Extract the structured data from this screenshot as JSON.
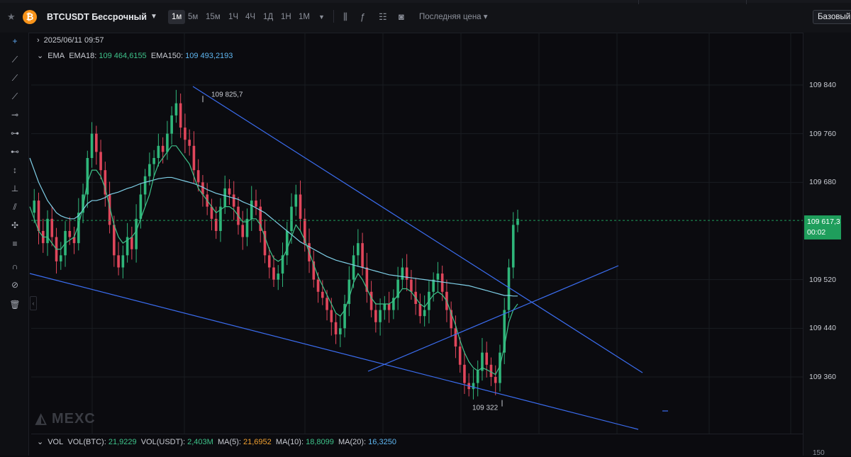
{
  "header": {
    "symbol": "BTCUSDT Бессрочный",
    "timeframes": [
      "1м",
      "5м",
      "15м",
      "1Ч",
      "4Ч",
      "1Д",
      "1Н",
      "1М"
    ],
    "active_timeframe": "1м",
    "last_price_label": "Последняя цена",
    "basic_button": "Базовый"
  },
  "legend": {
    "datetime": "2025/06/11 09:57",
    "ema_title": "EMA",
    "ema18_label": "EMA18:",
    "ema18_value": "109 464,6155",
    "ema150_label": "EMA150:",
    "ema150_value": "109 493,2193"
  },
  "volume": {
    "title": "VOL",
    "btc_label": "VOL(BTC):",
    "btc_value": "21,9229",
    "usdt_label": "VOL(USDT):",
    "usdt_value": "2,403M",
    "ma5_label": "MA(5):",
    "ma5_value": "21,6952",
    "ma10_label": "MA(10):",
    "ma10_value": "18,8099",
    "ma20_label": "MA(20):",
    "ma20_value": "16,3250"
  },
  "watermark": "MEXC",
  "bottom_axis_partial": "150",
  "colors": {
    "up": "#2fb67a",
    "down": "#e0465b",
    "ema18": "#3ec28a",
    "ema150": "#7fd0e8",
    "trendline": "#3b6df0",
    "current": "#1f9e5c"
  },
  "chart_data": {
    "type": "candlestick",
    "ylim": [
      109290,
      109890
    ],
    "yticks": [
      "109 840",
      "109 760",
      "109 680",
      "109 520",
      "109 440",
      "109 360"
    ],
    "ytick_values": [
      109840,
      109760,
      109680,
      109520,
      109440,
      109360
    ],
    "current_price": "109 617,3",
    "current_price_value": 109617.3,
    "countdown": "00:02",
    "high_annotation": "109 825,7",
    "high_value": 109825.7,
    "low_annotation": "109 322",
    "low_value": 109322,
    "close_series": [
      109630,
      109650,
      109600,
      109580,
      109620,
      109590,
      109550,
      109560,
      109600,
      109590,
      109580,
      109630,
      109660,
      109720,
      109760,
      109730,
      109700,
      109660,
      109610,
      109560,
      109540,
      109560,
      109590,
      109570,
      109620,
      109660,
      109690,
      109710,
      109720,
      109740,
      109730,
      109760,
      109790,
      109810,
      109770,
      109750,
      109740,
      109700,
      109680,
      109660,
      109640,
      109620,
      109600,
      109640,
      109670,
      109660,
      109640,
      109610,
      109590,
      109620,
      109650,
      109640,
      109600,
      109560,
      109540,
      109520,
      109530,
      109560,
      109600,
      109640,
      109660,
      109620,
      109580,
      109550,
      109520,
      109500,
      109490,
      109470,
      109450,
      109430,
      109440,
      109480,
      109520,
      109560,
      109580,
      109540,
      109500,
      109470,
      109450,
      109470,
      109480,
      109470,
      109490,
      109520,
      109540,
      109520,
      109500,
      109480,
      109460,
      109470,
      109500,
      109520,
      109530,
      109500,
      109470,
      109440,
      109410,
      109380,
      109350,
      109340,
      109350,
      109370,
      109400,
      109380,
      109360,
      109350,
      109400,
      109470,
      109540,
      109610,
      109620
    ],
    "ema18_series": [
      109640,
      109620,
      109600,
      109590,
      109590,
      109580,
      109570,
      109570,
      109580,
      109585,
      109590,
      109610,
      109640,
      109680,
      109700,
      109700,
      109690,
      109670,
      109640,
      109610,
      109590,
      109580,
      109585,
      109590,
      109600,
      109620,
      109640,
      109660,
      109690,
      109710,
      109720,
      109730,
      109740,
      109740,
      109730,
      109720,
      109710,
      109690,
      109670,
      109660,
      109650,
      109640,
      109630,
      109635,
      109640,
      109640,
      109635,
      109625,
      109615,
      109615,
      109620,
      109620,
      109610,
      109590,
      109570,
      109555,
      109550,
      109555,
      109570,
      109590,
      109610,
      109600,
      109585,
      109565,
      109545,
      109525,
      109510,
      109495,
      109480,
      109465,
      109460,
      109470,
      109490,
      109515,
      109530,
      109520,
      109505,
      109490,
      109480,
      109480,
      109480,
      109480,
      109485,
      109495,
      109505,
      109505,
      109500,
      109490,
      109480,
      109475,
      109485,
      109495,
      109500,
      109495,
      109485,
      109465,
      109445,
      109420,
      109400,
      109385,
      109375,
      109370,
      109375,
      109372,
      109368,
      109364,
      109378,
      109410,
      109450,
      109470,
      109480
    ],
    "ema150_series": [
      109720,
      109700,
      109680,
      109665,
      109650,
      109640,
      109630,
      109625,
      109622,
      109620,
      109620,
      109625,
      109635,
      109645,
      109650,
      109650,
      109652,
      109655,
      109660,
      109662,
      109664,
      109667,
      109670,
      109672,
      109675,
      109678,
      109680,
      109682,
      109684,
      109686,
      109687,
      109688,
      109688,
      109686,
      109684,
      109682,
      109680,
      109678,
      109675,
      109672,
      109668,
      109665,
      109662,
      109660,
      109658,
      109656,
      109654,
      109652,
      109648,
      109645,
      109642,
      109638,
      109634,
      109630,
      109624,
      109618,
      109612,
      109606,
      109600,
      109594,
      109588,
      109582,
      109578,
      109574,
      109570,
      109566,
      109562,
      109558,
      109555,
      109552,
      109550,
      109548,
      109546,
      109544,
      109542,
      109540,
      109538,
      109536,
      109534,
      109532,
      109530,
      109528,
      109527,
      109526,
      109525,
      109524,
      109523,
      109522,
      109521,
      109520,
      109519,
      109518,
      109517,
      109516,
      109515,
      109514,
      109513,
      109512,
      109511,
      109510,
      109508,
      109506,
      109504,
      109502,
      109500,
      109498,
      109496,
      109494,
      109494,
      109493,
      109493
    ]
  }
}
